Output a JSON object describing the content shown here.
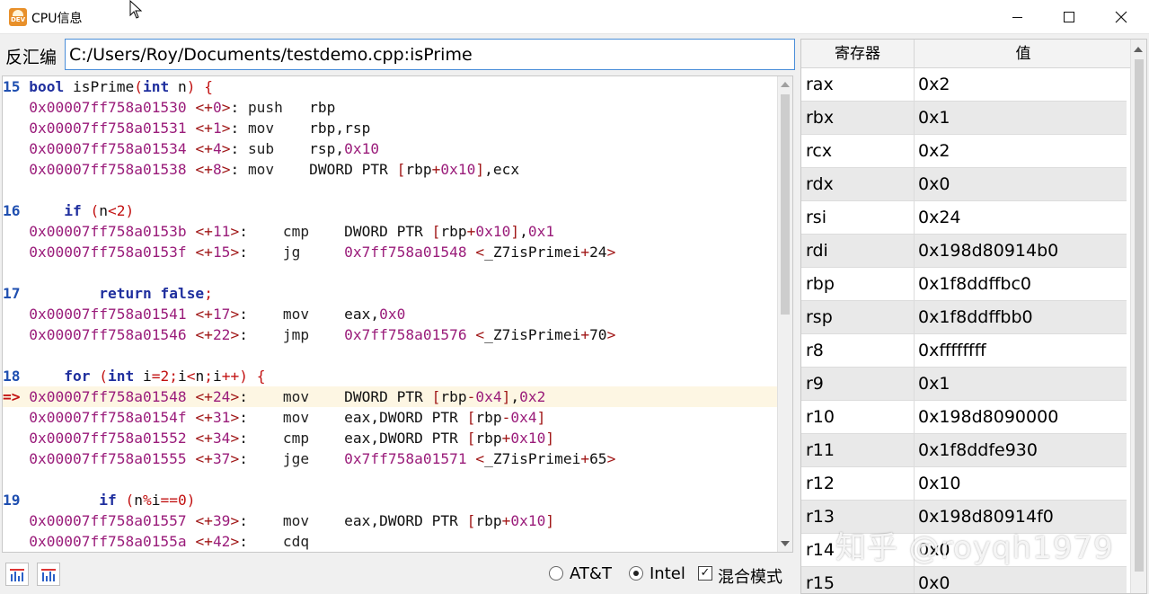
{
  "window": {
    "title": "CPU信息",
    "app_icon_text": "DEV"
  },
  "disassembly": {
    "label": "反汇编",
    "value": "C:/Users/Roy/Documents/testdemo.cpp:isPrime"
  },
  "code_lines": [
    {
      "kind": "src",
      "num": "15",
      "text": " bool isPrime(int n) {"
    },
    {
      "kind": "asm",
      "addr": "0x00007ff758a01530",
      "off": "<+0>:",
      "op": "push",
      "args": "rbp",
      "wide": false
    },
    {
      "kind": "asm",
      "addr": "0x00007ff758a01531",
      "off": "<+1>:",
      "op": "mov",
      "args": "rbp,rsp",
      "wide": false
    },
    {
      "kind": "asm",
      "addr": "0x00007ff758a01534",
      "off": "<+4>:",
      "op": "sub",
      "args": "rsp,0x10",
      "wide": false
    },
    {
      "kind": "asm",
      "addr": "0x00007ff758a01538",
      "off": "<+8>:",
      "op": "mov",
      "args": "DWORD PTR [rbp+0x10],ecx",
      "wide": false
    },
    {
      "kind": "blank"
    },
    {
      "kind": "src",
      "num": "16",
      "text": "     if (n<2)"
    },
    {
      "kind": "asm",
      "addr": "0x00007ff758a0153b",
      "off": "<+11>:",
      "op": "cmp",
      "args": "DWORD PTR [rbp+0x10],0x1",
      "wide": true
    },
    {
      "kind": "asm",
      "addr": "0x00007ff758a0153f",
      "off": "<+15>:",
      "op": "jg",
      "args": "0x7ff758a01548 <_Z7isPrimei+24>",
      "wide": true
    },
    {
      "kind": "blank"
    },
    {
      "kind": "src",
      "num": "17",
      "text": "         return false;"
    },
    {
      "kind": "asm",
      "addr": "0x00007ff758a01541",
      "off": "<+17>:",
      "op": "mov",
      "args": "eax,0x0",
      "wide": true
    },
    {
      "kind": "asm",
      "addr": "0x00007ff758a01546",
      "off": "<+22>:",
      "op": "jmp",
      "args": "0x7ff758a01576 <_Z7isPrimei+70>",
      "wide": true
    },
    {
      "kind": "blank"
    },
    {
      "kind": "src",
      "num": "18",
      "text": "     for (int i=2;i<n;i++) {"
    },
    {
      "kind": "asm",
      "current": true,
      "arrow": "=>",
      "addr": "0x00007ff758a01548",
      "off": "<+24>:",
      "op": "mov",
      "args": "DWORD PTR [rbp-0x4],0x2",
      "wide": true
    },
    {
      "kind": "asm",
      "addr": "0x00007ff758a0154f",
      "off": "<+31>:",
      "op": "mov",
      "args": "eax,DWORD PTR [rbp-0x4]",
      "wide": true
    },
    {
      "kind": "asm",
      "addr": "0x00007ff758a01552",
      "off": "<+34>:",
      "op": "cmp",
      "args": "eax,DWORD PTR [rbp+0x10]",
      "wide": true
    },
    {
      "kind": "asm",
      "addr": "0x00007ff758a01555",
      "off": "<+37>:",
      "op": "jge",
      "args": "0x7ff758a01571 <_Z7isPrimei+65>",
      "wide": true
    },
    {
      "kind": "blank"
    },
    {
      "kind": "src",
      "num": "19",
      "text": "         if (n%i==0)"
    },
    {
      "kind": "asm",
      "addr": "0x00007ff758a01557",
      "off": "<+39>:",
      "op": "mov",
      "args": "eax,DWORD PTR [rbp+0x10]",
      "wide": true
    },
    {
      "kind": "asm",
      "addr": "0x00007ff758a0155a",
      "off": "<+42>:",
      "op": "cdq",
      "args": "",
      "wide": true
    }
  ],
  "syntax": {
    "keywords": [
      "bool",
      "int",
      "if",
      "return",
      "false",
      "for"
    ]
  },
  "options": {
    "att_label": "AT&T",
    "intel_label": "Intel",
    "mixed_label": "混合模式",
    "att_selected": false,
    "intel_selected": true,
    "mixed_checked": true,
    "check_mark": "✓"
  },
  "registers": {
    "header_name": "寄存器",
    "header_value": "值",
    "rows": [
      {
        "name": "rax",
        "value": "0x2"
      },
      {
        "name": "rbx",
        "value": "0x1"
      },
      {
        "name": "rcx",
        "value": "0x2"
      },
      {
        "name": "rdx",
        "value": "0x0"
      },
      {
        "name": "rsi",
        "value": "0x24"
      },
      {
        "name": "rdi",
        "value": "0x198d80914b0"
      },
      {
        "name": "rbp",
        "value": "0x1f8ddffbc0"
      },
      {
        "name": "rsp",
        "value": "0x1f8ddffbb0"
      },
      {
        "name": "r8",
        "value": "0xffffffff"
      },
      {
        "name": "r9",
        "value": "0x1"
      },
      {
        "name": "r10",
        "value": "0x198d8090000"
      },
      {
        "name": "r11",
        "value": "0x1f8ddfe930"
      },
      {
        "name": "r12",
        "value": "0x10"
      },
      {
        "name": "r13",
        "value": "0x198d80914f0"
      },
      {
        "name": "r14",
        "value": "0x0"
      },
      {
        "name": "r15",
        "value": "0x0"
      }
    ]
  },
  "watermark": "知乎 @royqh1979"
}
